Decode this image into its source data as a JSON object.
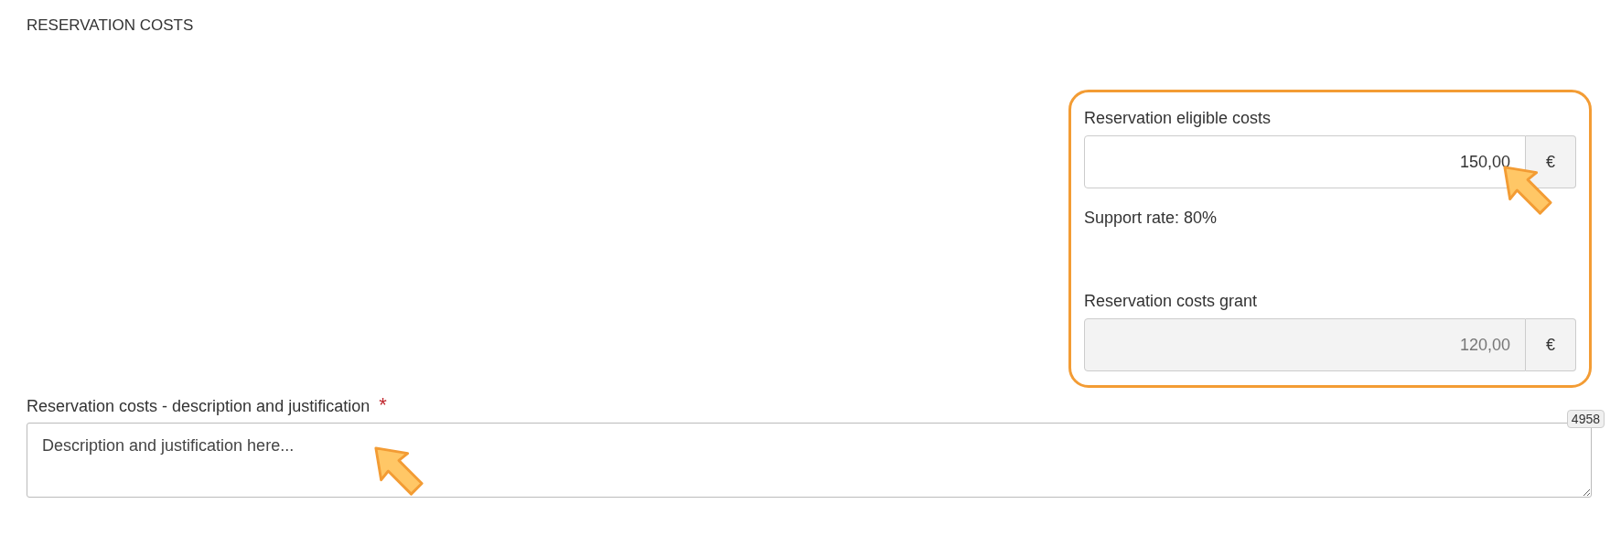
{
  "section_title": "RESERVATION COSTS",
  "summary_panel": {
    "fields": [
      {
        "label": "Reservation eligible costs",
        "value": "150,00",
        "unit": "€",
        "disabled": false
      },
      {
        "label": "Reservation costs grant",
        "value": "120,00",
        "unit": "€",
        "disabled": true
      }
    ],
    "support_rate": "Support rate: 80%"
  },
  "description": {
    "label": "Reservation costs - description and justification",
    "required_mark": "*",
    "value": "Description and justification here...",
    "counter": "4958"
  }
}
